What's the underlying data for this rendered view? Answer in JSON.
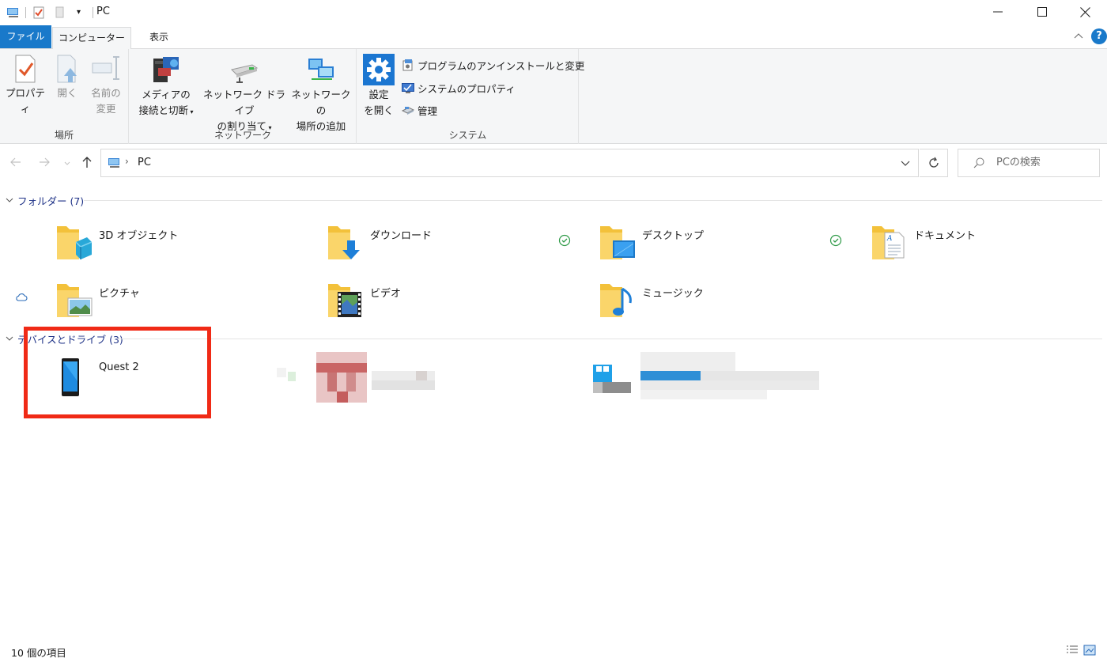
{
  "window": {
    "title": "PC",
    "minimize_symbol": "—",
    "maximize_symbol": "☐",
    "close_symbol": "✕"
  },
  "tabs": {
    "file": "ファイル",
    "computer": "コンピューター",
    "view": "表示",
    "help": "?"
  },
  "ribbon": {
    "groups": {
      "location": "場所",
      "network": "ネットワーク",
      "system": "システム"
    },
    "properties": "プロパティ",
    "open": "開く",
    "rename_line1": "名前の",
    "rename_line2": "変更",
    "media_line1": "メディアの",
    "media_line2": "接続と切断",
    "map_drive_line1": "ネットワーク ドライブ",
    "map_drive_line2": "の割り当て",
    "add_location_line1": "ネットワークの",
    "add_location_line2": "場所の追加",
    "settings_line1": "設定",
    "settings_line2": "を開く",
    "uninstall": "プログラムのアンインストールと変更",
    "system_properties": "システムのプロパティ",
    "manage": "管理"
  },
  "address": {
    "path": "PC",
    "search_placeholder": "PCの検索"
  },
  "content": {
    "folders_header": "フォルダー (7)",
    "devices_header": "デバイスとドライブ (3)",
    "folders": [
      {
        "name": "3D オブジェクト"
      },
      {
        "name": "ダウンロード"
      },
      {
        "name": "デスクトップ"
      },
      {
        "name": "ドキュメント"
      },
      {
        "name": "ピクチャ"
      },
      {
        "name": "ビデオ"
      },
      {
        "name": "ミュージック"
      }
    ],
    "devices": [
      {
        "name": "Quest 2"
      }
    ]
  },
  "status": {
    "item_count": "10 個の項目"
  },
  "colors": {
    "accent": "#1979ca",
    "highlight_box": "#f02a16",
    "section_header": "#1e3287",
    "folder_yellow": "#f7c844"
  }
}
